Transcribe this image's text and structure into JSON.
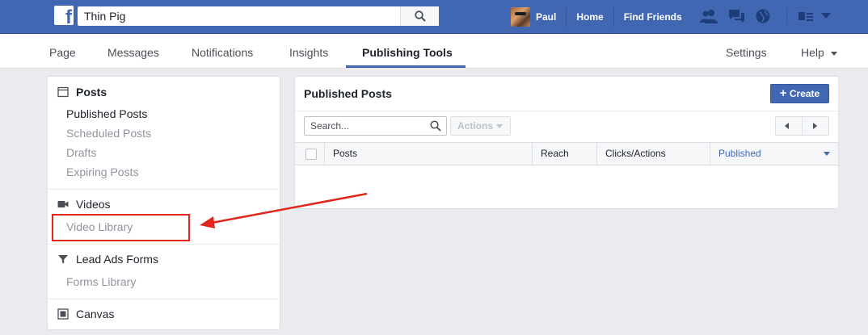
{
  "topbar": {
    "search_value": "Thin Pig",
    "user_name": "Paul",
    "home": "Home",
    "find_friends": "Find Friends"
  },
  "tabs": {
    "page": "Page",
    "messages": "Messages",
    "notifications": "Notifications",
    "insights": "Insights",
    "publishing_tools": "Publishing Tools",
    "settings": "Settings",
    "help": "Help"
  },
  "sidebar": {
    "posts_header": "Posts",
    "posts_items": [
      "Published Posts",
      "Scheduled Posts",
      "Drafts",
      "Expiring Posts"
    ],
    "videos_header": "Videos",
    "videos_items": [
      "Video Library"
    ],
    "leads_header": "Lead Ads Forms",
    "leads_items": [
      "Forms Library"
    ],
    "canvas_header": "Canvas"
  },
  "main": {
    "title": "Published Posts",
    "create_label": "Create",
    "search_placeholder": "Search...",
    "actions_label": "Actions",
    "columns": [
      "Posts",
      "Reach",
      "Clicks/Actions",
      "Published"
    ],
    "sorted_column": "Published"
  },
  "colors": {
    "brand_blue": "#4267b2",
    "annotation_red": "#e0261d"
  }
}
